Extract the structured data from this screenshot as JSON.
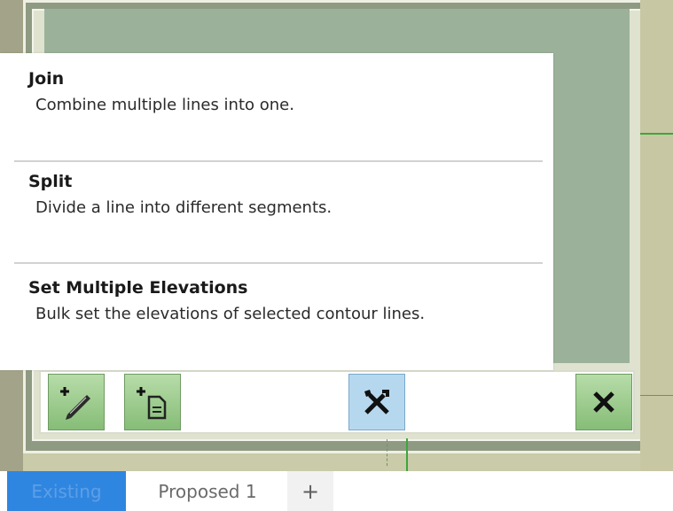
{
  "menu": {
    "items": [
      {
        "title": "Join",
        "description": "Combine multiple lines into one."
      },
      {
        "title": "Split",
        "description": "Divide a line into different segments."
      },
      {
        "title": "Set Multiple Elevations",
        "description": "Bulk set the elevations of selected contour lines."
      }
    ]
  },
  "toolbar": {
    "buttons": [
      {
        "icon": "add-line-pencil-icon",
        "active": false
      },
      {
        "icon": "add-document-icon",
        "active": false
      },
      {
        "icon": "tools-icon",
        "active": true
      },
      {
        "icon": "close-icon",
        "active": false
      }
    ]
  },
  "tabs": [
    {
      "label": "Existing",
      "active": true
    },
    {
      "label": "Proposed 1",
      "active": false
    },
    {
      "label": "+",
      "active": false
    }
  ],
  "colors": {
    "active_tab": "#2f86e0",
    "map_green": "#9bb19a",
    "button_green": "#86bd77",
    "active_button": "#b6d8ef"
  }
}
